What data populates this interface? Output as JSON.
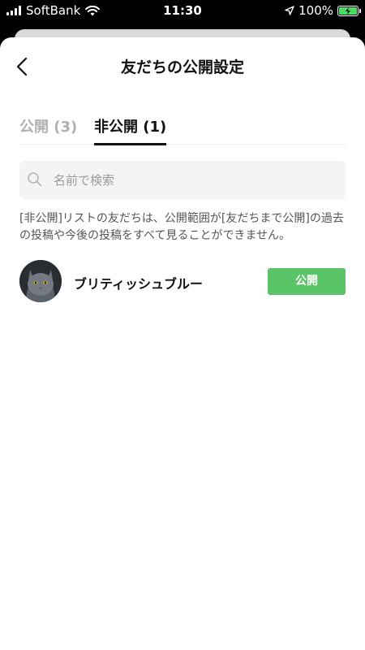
{
  "status_bar": {
    "carrier": "SoftBank",
    "time": "11:30",
    "battery": "100%"
  },
  "header": {
    "title": "友だちの公開設定",
    "back_icon": "chevron-left-icon"
  },
  "tabs": [
    {
      "label": "公開 (3)",
      "active": false
    },
    {
      "label": "非公開 (1)",
      "active": true
    }
  ],
  "search": {
    "placeholder": "名前で検索",
    "value": ""
  },
  "description": "[非公開]リストの友だちは、公開範囲が[友だちまで公開]の過去の投稿や今後の投稿をすべて見ることができません。",
  "friends": [
    {
      "name": "ブリティッシュブルー",
      "action_label": "公開",
      "avatar_icon": "cat-avatar"
    }
  ],
  "colors": {
    "accent_green": "#5ac466",
    "active_tab": "#111111",
    "inactive_tab": "#b0b0b0"
  }
}
